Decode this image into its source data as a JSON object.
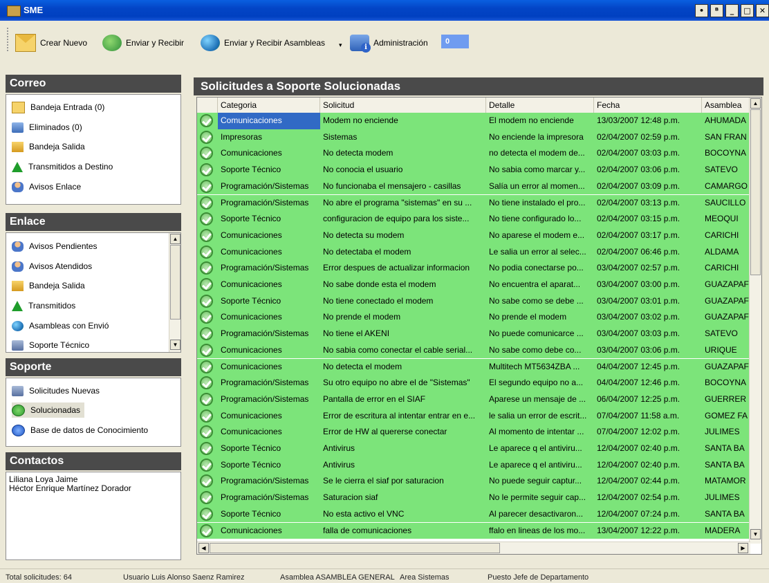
{
  "window": {
    "title": "SME",
    "controls": [
      "•",
      "ᴮ",
      "_",
      "□",
      "✕"
    ]
  },
  "toolbar": {
    "create_label": "Crear Nuevo",
    "send_receive_label": "Enviar y Recibir",
    "send_receive_assemblies_label": "Enviar y Recibir Asambleas",
    "dropdown_arrow": "▾",
    "admin_label": "Administración",
    "badge_value": "0"
  },
  "correo": {
    "title": "Correo",
    "items": [
      {
        "label": "Bandeja Entrada (0)",
        "icon": "inbox-icon"
      },
      {
        "label": "Eliminados (0)",
        "icon": "trash-icon"
      },
      {
        "label": "Bandeja Salida",
        "icon": "outbox-icon"
      },
      {
        "label": "Transmitidos a Destino",
        "icon": "arrow-up-icon"
      },
      {
        "label": "Avisos Enlace",
        "icon": "link-alert-icon"
      }
    ]
  },
  "enlace": {
    "title": "Enlace",
    "items": [
      {
        "label": "Avisos Pendientes",
        "icon": "pending-alerts-icon"
      },
      {
        "label": "Avisos Atendidos",
        "icon": "attended-alerts-icon"
      },
      {
        "label": "Bandeja Salida",
        "icon": "outbox-icon"
      },
      {
        "label": "Transmitidos",
        "icon": "arrow-up-icon"
      },
      {
        "label": "Asambleas con Envió",
        "icon": "globe-icon"
      },
      {
        "label": "Soporte Técnico",
        "icon": "computer-icon"
      }
    ]
  },
  "soporte": {
    "title": "Soporte",
    "items": [
      {
        "label": "Solicitudes Nuevas",
        "icon": "computer-icon"
      },
      {
        "label": "Solucionadas",
        "icon": "check-icon"
      },
      {
        "label": "Base de datos de Conocimiento",
        "icon": "help-icon"
      }
    ]
  },
  "contactos": {
    "title": "Contactos",
    "names": [
      "Liliana Loya Jaime",
      "Héctor Enrique Martínez Dorador"
    ]
  },
  "grid": {
    "title": "Solicitudes a Soporte Solucionadas",
    "columns": [
      "Categoria",
      "Solicitud",
      "Detalle",
      "Fecha",
      "Asamblea"
    ],
    "rows": [
      [
        "Comunicaciones",
        "Modem no enciende",
        "El modem no enciende",
        "13/03/2007 12:48 p.m.",
        "AHUMADA"
      ],
      [
        "Impresoras",
        "Sistemas",
        "No enciende la impresora",
        "02/04/2007 02:59 p.m.",
        "SAN FRAN"
      ],
      [
        "Comunicaciones",
        "No detecta modem",
        "no detecta el modem de...",
        "02/04/2007 03:03 p.m.",
        "BOCOYNA"
      ],
      [
        "Soporte Técnico",
        "No conocia el usuario",
        "No sabia como marcar y...",
        "02/04/2007 03:06 p.m.",
        "SATEVO"
      ],
      [
        "Programación/Sistemas",
        "No funcionaba el mensajero - casillas",
        "Salía un error al momen...",
        "02/04/2007 03:09 p.m.",
        "CAMARGO"
      ],
      [
        "Programación/Sistemas",
        "No abre el programa \"sistemas\" en su ...",
        "No tiene instalado el pro...",
        "02/04/2007 03:13 p.m.",
        "SAUCILLO"
      ],
      [
        "Soporte Técnico",
        "configuracion de equipo para los siste...",
        "No tiene configurado lo...",
        "02/04/2007 03:15 p.m.",
        "MEOQUI"
      ],
      [
        "Comunicaciones",
        "No detecta su modem",
        "No aparese el modem e...",
        "02/04/2007 03:17 p.m.",
        "CARICHI"
      ],
      [
        "Comunicaciones",
        "No detectaba el modem",
        "Le salia un error al selec...",
        "02/04/2007 06:46 p.m.",
        "ALDAMA"
      ],
      [
        "Programación/Sistemas",
        "Error despues de actualizar informacion",
        "No podia conectarse po...",
        "03/04/2007 02:57 p.m.",
        "CARICHI"
      ],
      [
        "Comunicaciones",
        "No sabe donde esta el modem",
        "No encuentra el aparat...",
        "03/04/2007 03:00 p.m.",
        "GUAZAPAF"
      ],
      [
        "Soporte Técnico",
        "No tiene conectado el modem",
        "No sabe como se debe ...",
        "03/04/2007 03:01 p.m.",
        "GUAZAPAF"
      ],
      [
        "Comunicaciones",
        "No prende el modem",
        "No prende el modem",
        "03/04/2007 03:02 p.m.",
        "GUAZAPAF"
      ],
      [
        "Programación/Sistemas",
        "No tiene el AKENI",
        "No puede comunicarce ...",
        "03/04/2007 03:03 p.m.",
        "SATEVO"
      ],
      [
        "Comunicaciones",
        "No sabia como conectar el cable serial...",
        "No sabe como debe co...",
        "03/04/2007 03:06 p.m.",
        "URIQUE"
      ],
      [
        "Comunicaciones",
        "No detecta el modem",
        "Multitech MT5634ZBA ...",
        "04/04/2007 12:45 p.m.",
        "GUAZAPAF"
      ],
      [
        "Programación/Sistemas",
        "Su otro equipo no abre el de \"Sistemas\"",
        "El segundo equipo no a...",
        "04/04/2007 12:46 p.m.",
        "BOCOYNA"
      ],
      [
        "Programación/Sistemas",
        "Pantalla de error en el SIAF",
        "Aparese un mensaje de ...",
        "06/04/2007 12:25 p.m.",
        "GUERRER"
      ],
      [
        "Comunicaciones",
        "Error de escritura al intentar entrar en e...",
        "le salia un error de escrit...",
        "07/04/2007 11:58 a.m.",
        "GOMEZ FA"
      ],
      [
        "Comunicaciones",
        "Error de HW al quererse conectar",
        "Al momento de intentar ...",
        "07/04/2007 12:02 p.m.",
        "JULIMES"
      ],
      [
        "Soporte Técnico",
        "Antivirus",
        "Le aparece q el antiviru...",
        "12/04/2007 02:40 p.m.",
        "SANTA BA"
      ],
      [
        "Soporte Técnico",
        "Antivirus",
        "Le aparece q el antiviru...",
        "12/04/2007 02:40 p.m.",
        "SANTA BA"
      ],
      [
        "Programación/Sistemas",
        "Se le cierra el siaf por saturacion",
        "No puede seguir captur...",
        "12/04/2007 02:44 p.m.",
        "MATAMOR"
      ],
      [
        "Programación/Sistemas",
        "Saturacion siaf",
        "No le permite seguir cap...",
        "12/04/2007 02:54 p.m.",
        "JULIMES"
      ],
      [
        "Soporte Técnico",
        "No esta activo el VNC",
        "Al parecer desactivaron...",
        "12/04/2007 07:24 p.m.",
        "SANTA BA"
      ],
      [
        "Comunicaciones",
        "falla de comunicaciones",
        "ffalo en lineas de los mo...",
        "13/04/2007 12:22 p.m.",
        "MADERA"
      ]
    ],
    "selected_row": 0,
    "row_color": "#7ce47a"
  },
  "status": {
    "total": "Total solicitudes: 64",
    "user": "Usuario Luis Alonso Saenz Ramirez",
    "assembly": "Asamblea ASAMBLEA GENERAL",
    "area": "Area Sistemas",
    "position": "Puesto Jefe de Departamento"
  }
}
